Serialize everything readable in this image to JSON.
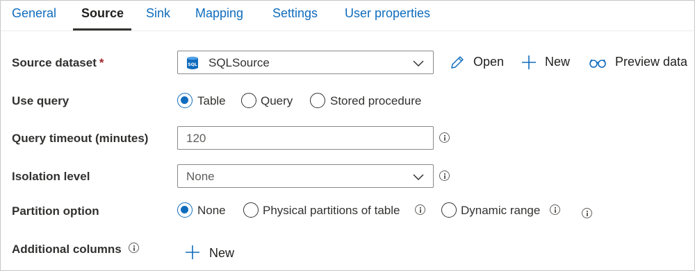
{
  "tabs": [
    "General",
    "Source",
    "Sink",
    "Mapping",
    "Settings",
    "User properties"
  ],
  "active_tab": "Source",
  "source_dataset": {
    "label": "Source dataset",
    "required_marker": "*",
    "value": "SQLSource",
    "icon": "sql-database-icon"
  },
  "actions": {
    "open": "Open",
    "new": "New",
    "preview": "Preview data"
  },
  "use_query": {
    "label": "Use query",
    "options": [
      "Table",
      "Query",
      "Stored procedure"
    ],
    "selected": "Table"
  },
  "query_timeout": {
    "label": "Query timeout (minutes)",
    "value": "120"
  },
  "isolation_level": {
    "label": "Isolation level",
    "value": "None"
  },
  "partition_option": {
    "label": "Partition option",
    "options": [
      "None",
      "Physical partitions of table",
      "Dynamic range"
    ],
    "selected": "None"
  },
  "additional_columns": {
    "label": "Additional columns",
    "new_label": "New"
  },
  "colors": {
    "accent": "#0f6cbd",
    "required": "#a4262c",
    "text": "#323130"
  }
}
